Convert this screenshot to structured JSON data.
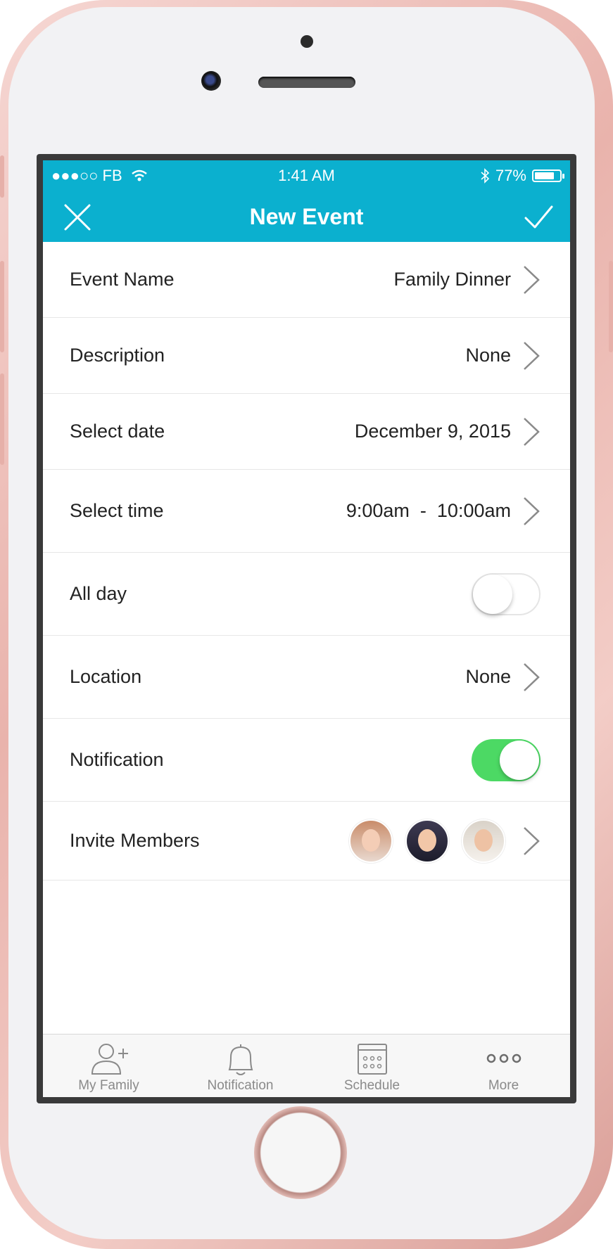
{
  "status_bar": {
    "carrier": "●●●○○ FB",
    "time": "1:41 AM",
    "battery": "77%"
  },
  "navbar": {
    "title": "New Event"
  },
  "rows": {
    "event_name": {
      "label": "Event Name",
      "value": "Family Dinner"
    },
    "description": {
      "label": "Description",
      "value": "None"
    },
    "date": {
      "label": "Select date",
      "value": "December 9, 2015"
    },
    "time": {
      "label": "Select time",
      "value": "9:00am  -  10:00am"
    },
    "all_day": {
      "label": "All day",
      "on": false
    },
    "location": {
      "label": "Location",
      "value": "None"
    },
    "notification": {
      "label": "Notification",
      "on": true
    },
    "invite": {
      "label": "Invite Members"
    }
  },
  "tabs": [
    "My Family",
    "Notification",
    "Schedule",
    "More"
  ],
  "colors": {
    "accent": "#0bb0cf",
    "toggle_on": "#4cd964"
  }
}
